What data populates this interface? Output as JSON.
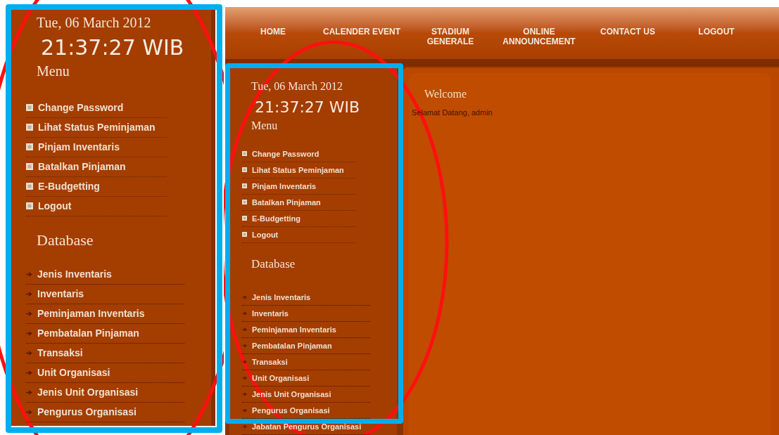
{
  "zoomed_panel": {
    "date": "Tue, 06 March 2012",
    "time": "21:37:27 WIB",
    "menu_title": "Menu",
    "menu_items": [
      "Change Password",
      "Lihat Status Peminjaman",
      "Pinjam Inventaris",
      "Batalkan Pinjaman",
      "E-Budgetting",
      "Logout"
    ],
    "database_title": "Database",
    "database_items": [
      "Jenis Inventaris",
      "Inventaris",
      "Peminjaman Inventaris",
      "Pembatalan Pinjaman",
      "Transaksi",
      "Unit Organisasi",
      "Jenis Unit Organisasi",
      "Pengurus Organisasi"
    ]
  },
  "page": {
    "nav": [
      "HOME",
      "CALENDER EVENT",
      "STADIUM GENERALE",
      "ONLINE ANNOUNCEMENT",
      "CONTACT US",
      "LOGOUT"
    ],
    "sidebar": {
      "date": "Tue, 06 March 2012",
      "time": "21:37:27 WIB",
      "menu_title": "Menu",
      "menu_items": [
        "Change Password",
        "Lihat Status Peminjaman",
        "Pinjam Inventaris",
        "Batalkan Pinjaman",
        "E-Budgetting",
        "Logout"
      ],
      "database_title": "Database",
      "database_items": [
        "Jenis Inventaris",
        "Inventaris",
        "Peminjaman Inventaris",
        "Pembatalan Pinjaman",
        "Transaksi",
        "Unit Organisasi",
        "Jenis Unit Organisasi",
        "Pengurus Organisasi",
        "Jabatan Pengurus Organisasi"
      ]
    },
    "content": {
      "title": "Welcome",
      "text": "Selamat Datang, admin"
    }
  }
}
